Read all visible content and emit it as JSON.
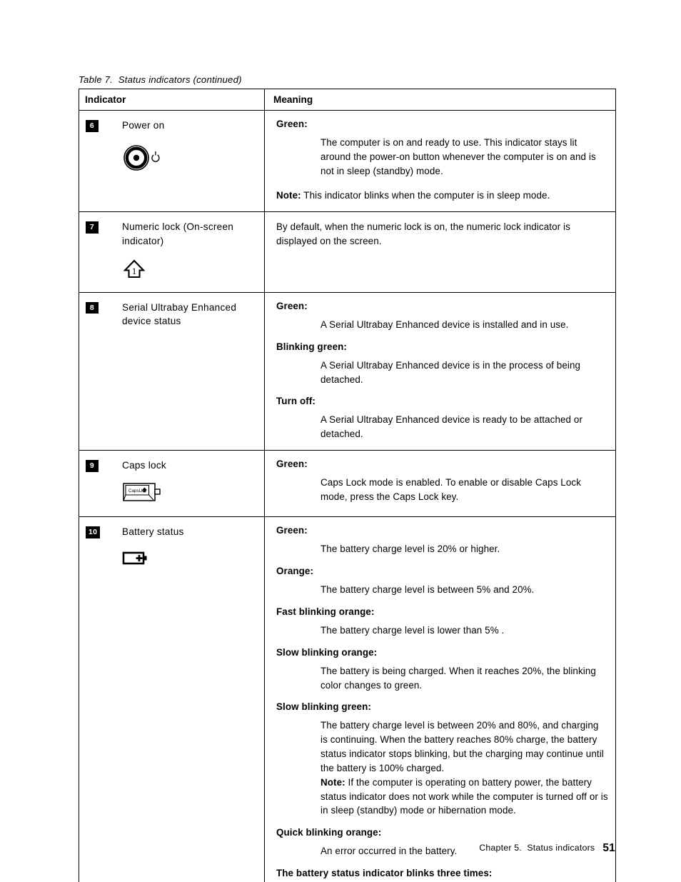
{
  "caption": "Table 7.  Status indicators (continued)",
  "table": {
    "headers": {
      "indicator": "Indicator",
      "meaning": "Meaning"
    },
    "rows": [
      {
        "number": "6",
        "label": "Power on",
        "icon": "power-on-indicator-icon",
        "terms": [
          {
            "term": "Green:",
            "definition": "The computer is on and ready to use.  This indicator stays lit around the power-on button whenever the computer is on and is not in sleep (standby) mode."
          }
        ],
        "note_label": "Note:",
        "note_text": " This indicator blinks when the computer is in sleep mode."
      },
      {
        "number": "7",
        "label": "Numeric lock (On-screen\nindicator)",
        "icon": "numeric-lock-arrow-icon",
        "plain": "By default, when the numeric lock is on, the numeric lock indicator is displayed on the screen."
      },
      {
        "number": "8",
        "label": "Serial Ultrabay Enhanced\ndevice status",
        "icon": null,
        "terms": [
          {
            "term": "Green:",
            "definition": "A Serial Ultrabay Enhanced device is installed and in use."
          },
          {
            "term": "Blinking green:",
            "definition": "A Serial Ultrabay Enhanced device is in the process of being detached."
          },
          {
            "term": "Turn off:",
            "definition": "A Serial Ultrabay Enhanced device is ready to be attached or detached."
          }
        ]
      },
      {
        "number": "9",
        "label": "Caps lock",
        "icon": "caps-lock-key-icon",
        "icon_key_label": "CapsLk",
        "terms": [
          {
            "term": "Green:",
            "definition": "Caps Lock mode is enabled.  To enable or disable Caps Lock mode, press the Caps Lock key."
          }
        ]
      },
      {
        "number": "10",
        "label": "Battery status",
        "icon": "battery-icon",
        "terms": [
          {
            "term": "Green:",
            "definition": "The battery charge level is 20% or higher."
          },
          {
            "term": "Orange:",
            "definition": "The battery charge level is between 5% and 20%."
          },
          {
            "term": "Fast blinking orange:",
            "definition": "The battery charge level is lower than 5% ."
          },
          {
            "term": "Slow blinking orange:",
            "definition": "The battery is being charged.  When it reaches 20%, the blinking color changes to green."
          },
          {
            "term": "Slow blinking green:",
            "definition": "The battery charge level is between 20% and 80%, and charging is continuing.  When the battery reaches 80% charge, the battery status indicator stops blinking, but the charging may continue until the battery is 100% charged.",
            "note_label": "Note:",
            "note_text": " If the computer is operating on battery power, the battery status indicator does not work while the computer is turned off or is in sleep (standby) mode or hibernation mode."
          },
          {
            "term": "Quick blinking orange:",
            "definition": "An error occurred in the battery."
          },
          {
            "term": "The battery status indicator blinks three times:",
            "definition": ""
          }
        ]
      }
    ]
  },
  "footer": {
    "chapter": "Chapter 5.  Status indicators",
    "page": "51"
  }
}
